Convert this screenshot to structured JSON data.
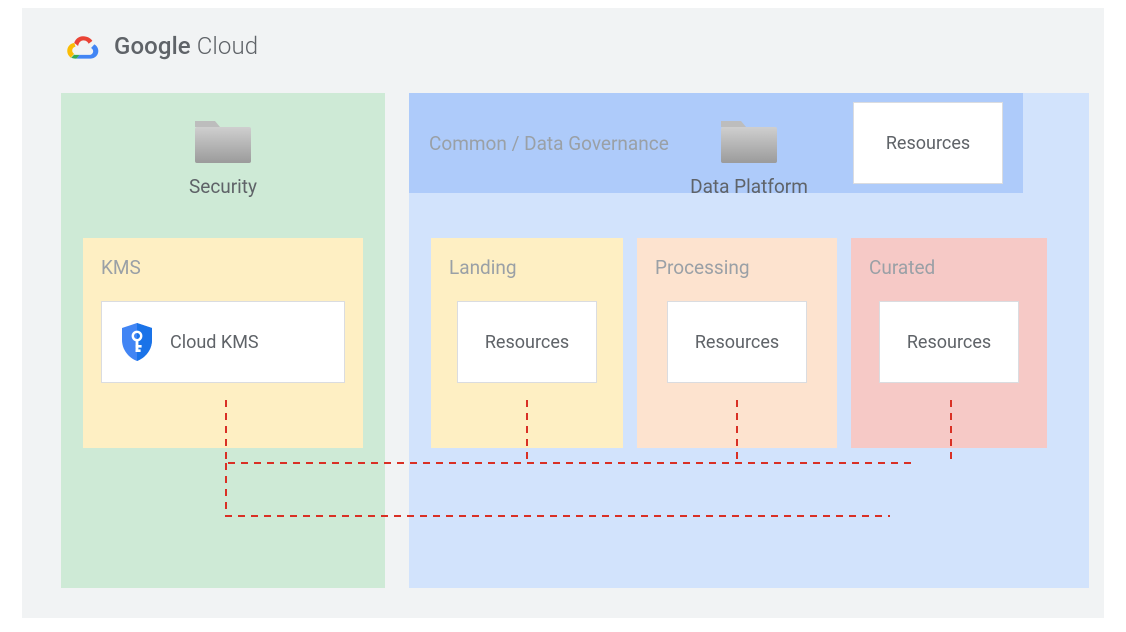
{
  "header": {
    "brand_bold": "Google",
    "brand_light": " Cloud"
  },
  "security": {
    "title": "Security",
    "kms": {
      "title": "KMS",
      "service": "Cloud KMS"
    }
  },
  "data_platform": {
    "title": "Data Platform",
    "landing": {
      "title": "Landing",
      "node": "Resources"
    },
    "processing": {
      "title": "Processing",
      "node": "Resources"
    },
    "curated": {
      "title": "Curated",
      "node": "Resources"
    },
    "governance": {
      "title": "Common / Data Governance",
      "node": "Resources"
    }
  },
  "colors": {
    "canvas": "#f1f3f4",
    "security_bg": "#ceead6",
    "data_bg": "#d2e3fc",
    "kms_bg": "#feefc3",
    "landing_bg": "#feefc3",
    "processing_bg": "#fde3cf",
    "curated_bg": "#f6c9c6",
    "governance_bg": "#aecbfa",
    "connector": "#d93025"
  }
}
